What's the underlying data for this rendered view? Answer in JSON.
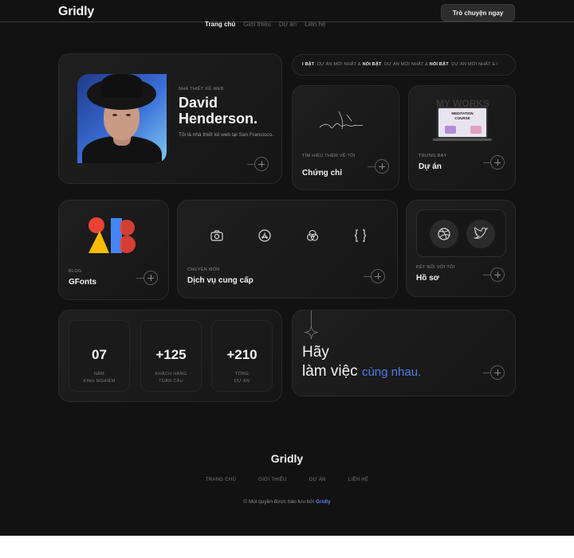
{
  "header": {
    "logo": "Gridly",
    "cta_label": "Trò chuyện ngay",
    "nav": [
      "Trang chủ",
      "Giới thiệu",
      "Dự án",
      "Liên hệ"
    ]
  },
  "profile": {
    "tag": "NHÀ THIẾT KẾ WEB",
    "name": "David Henderson.",
    "description": "Tôi là nhà thiết kế web tại San Francisco."
  },
  "marquee": {
    "bold1": "I BẬT",
    "text1": ". DỰ ÁN MỚI NHẤT & ",
    "bold2": "NỔI BẬT",
    "text2": ". DỰ ÁN MỚI NHẤT & ",
    "bold3": "NỔI BẬT",
    "text3": ". DỰ ÁN MỚI NHẤT & I"
  },
  "credentials": {
    "tag": "TÌM HIỂU THÊM VỀ TÔI",
    "title": "Chứng chỉ"
  },
  "projects": {
    "tag": "TRƯNG BÀY",
    "title": "Dự án",
    "image_heading": "MY WORKS",
    "image_caption_1": "MEDITATION",
    "image_caption_2": "COURSE"
  },
  "blog": {
    "tag": "BLOG",
    "title": "GFonts"
  },
  "services": {
    "tag": "CHUYÊN MÔN",
    "title": "Dịch vụ cung cấp",
    "icons": [
      "camera-icon",
      "app-store-icon",
      "color-circles-icon",
      "code-bracket-icon"
    ]
  },
  "social": {
    "tag": "KẾT NỐI VỚI TÔI",
    "title": "Hồ sơ",
    "icons": [
      "dribbble-icon",
      "twitter-icon"
    ]
  },
  "stats": [
    {
      "value": "07",
      "label_1": "NĂM",
      "label_2": "KINH NGHIỆM"
    },
    {
      "value": "+125",
      "label_1": "KHÁCH HÀNG",
      "label_2": "TOÀN CẦU"
    },
    {
      "value": "+210",
      "label_1": "TỔNG",
      "label_2": "DỰ ÁN"
    }
  ],
  "contact": {
    "line1": "Hãy",
    "line2": "làm việc",
    "highlight": "cùng nhau."
  },
  "footer": {
    "logo": "Gridly",
    "nav": [
      "TRANG CHỦ",
      "GIỚI THIỆU",
      "DỰ ÁN",
      "LIÊN HỆ"
    ],
    "copyright": "© Mọi quyền được bảo lưu bởi",
    "brand": "Gridly"
  },
  "colors": {
    "background": "#121212",
    "accent": "#4a7ee8",
    "card": "#1f1f1f"
  }
}
